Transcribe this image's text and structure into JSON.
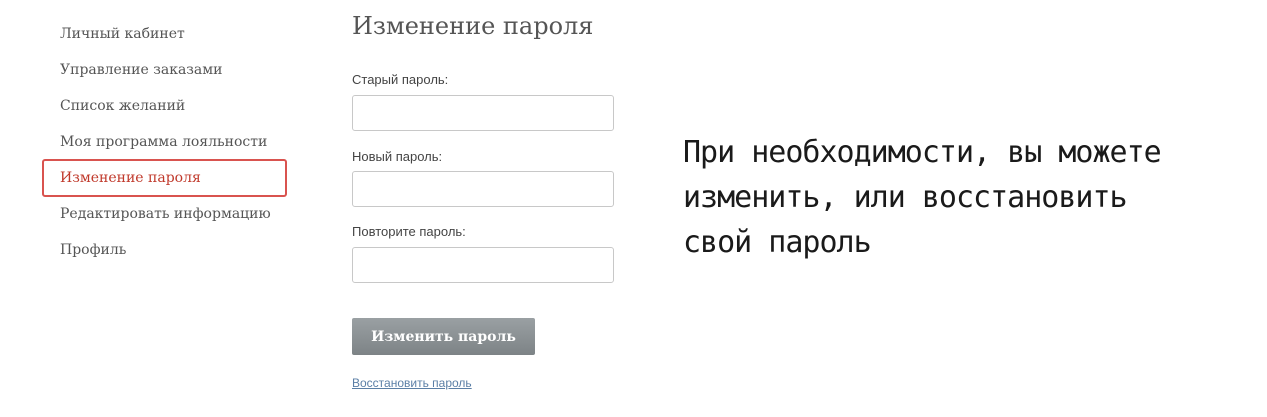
{
  "sidebar": {
    "items": [
      {
        "label": "Личный кабинет"
      },
      {
        "label": "Управление заказами"
      },
      {
        "label": "Список желаний"
      },
      {
        "label": "Моя программа лояльности"
      },
      {
        "label": "Изменение пароля",
        "active": true
      },
      {
        "label": "Редактировать информацию"
      },
      {
        "label": "Профиль"
      }
    ]
  },
  "form": {
    "title": "Изменение пароля",
    "old_password_label": "Старый пароль:",
    "old_password_value": "",
    "new_password_label": "Новый пароль:",
    "new_password_value": "",
    "repeat_password_label": "Повторите пароль:",
    "repeat_password_value": "",
    "submit_label": "Изменить пароль",
    "recover_link": "Восстановить пароль"
  },
  "annotation": {
    "lines": [
      "При необходимости, вы можете",
      "изменить, или восстановить",
      "свой пароль"
    ]
  },
  "colors": {
    "active_item": "#c0392b",
    "active_border": "#d9534f",
    "button": "#888e91",
    "link": "#5b7fa6"
  }
}
